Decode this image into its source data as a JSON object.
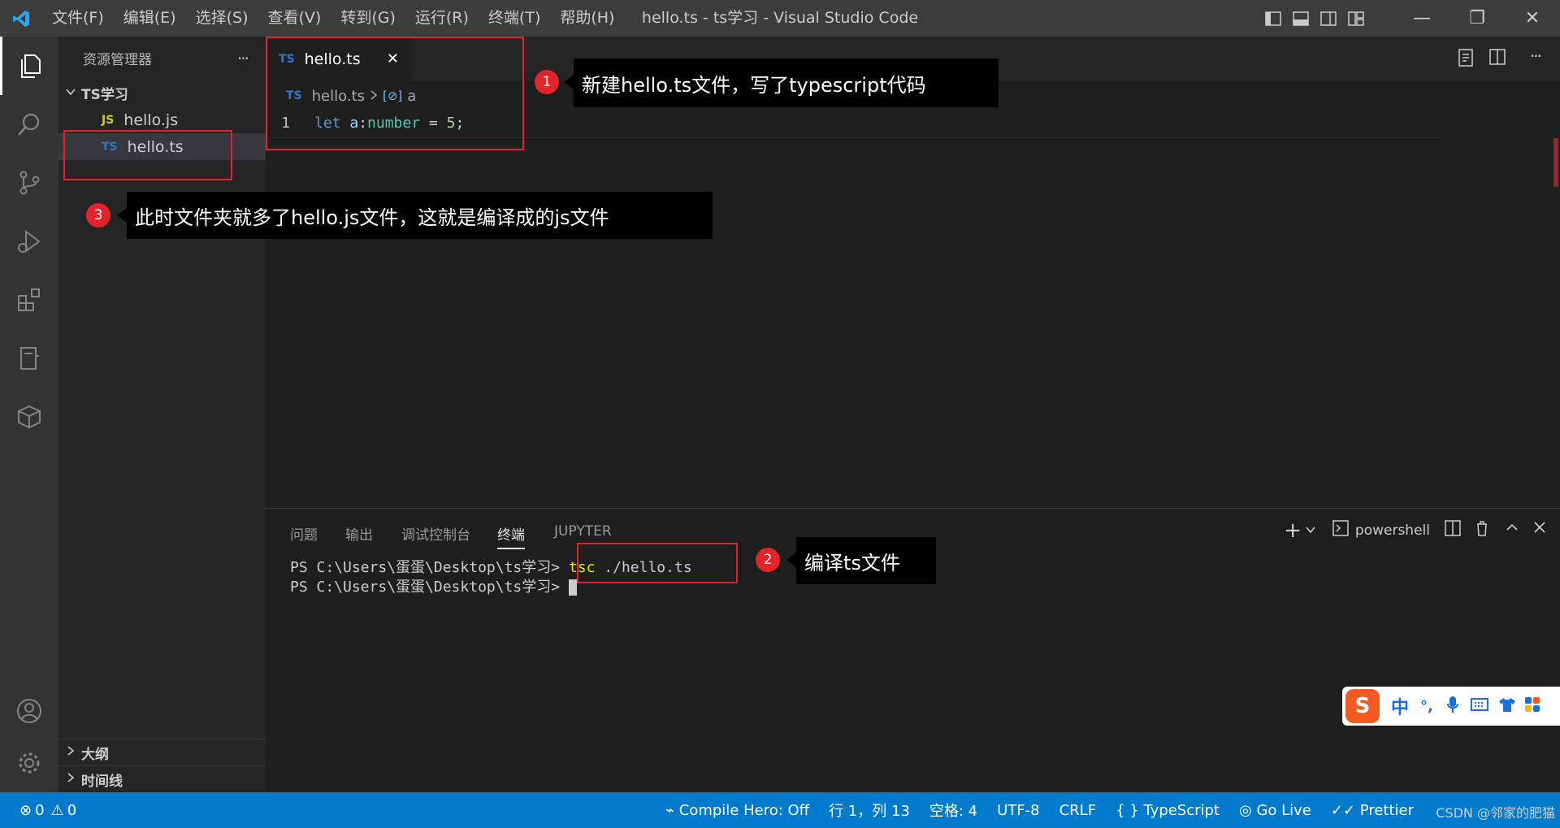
{
  "titlebar": {
    "menu": [
      "文件(F)",
      "编辑(E)",
      "选择(S)",
      "查看(V)",
      "转到(G)",
      "运行(R)",
      "终端(T)",
      "帮助(H)"
    ],
    "title": "hello.ts - ts学习 - Visual Studio Code",
    "min": "—",
    "max": "❐",
    "close": "✕"
  },
  "sidebar": {
    "title": "资源管理器",
    "more": "···",
    "folder": "TS学习",
    "files": [
      {
        "badge": "JS",
        "name": "hello.js"
      },
      {
        "badge": "TS",
        "name": "hello.ts"
      }
    ],
    "outline": "大纲",
    "timeline": "时间线"
  },
  "editor": {
    "tab": {
      "badge": "TS",
      "name": "hello.ts",
      "close": "✕"
    },
    "breadcrumb": {
      "badge": "TS",
      "file": "hello.ts",
      "symbol": "a"
    },
    "line_number": "1",
    "code": {
      "kw": "let ",
      "var": "a",
      "colon": ":",
      "type": "number",
      "rest": " = ",
      "num": "5",
      "semi": ";"
    }
  },
  "panel": {
    "tabs": [
      "问题",
      "输出",
      "调试控制台",
      "终端",
      "JUPYTER"
    ],
    "active_tab": "终端",
    "shell": "powershell",
    "lines": [
      {
        "prompt": "PS C:\\Users\\蛋蛋\\Desktop\\ts学习> ",
        "cmd": "tsc",
        "args": " ./hello.ts"
      },
      {
        "prompt": "PS C:\\Users\\蛋蛋\\Desktop\\ts学习> ",
        "cmd": "",
        "args": ""
      }
    ]
  },
  "statusbar": {
    "errors": "0",
    "warnings": "0",
    "compile_hero": "Compile Hero: Off",
    "position": "行 1，列 13",
    "spaces": "空格: 4",
    "encoding": "UTF-8",
    "eol": "CRLF",
    "language": "TypeScript",
    "go_live": "Go Live",
    "prettier": "Prettier",
    "watermark": "CSDN @邻家的肥猫"
  },
  "annotations": [
    {
      "num": "1",
      "text": "新建hello.ts文件，写了typescript代码"
    },
    {
      "num": "2",
      "text": "编译ts文件"
    },
    {
      "num": "3",
      "text": "此时文件夹就多了hello.js文件，这就是编译成的js文件"
    }
  ],
  "ime": {
    "lang": "中",
    "punct": "°,"
  },
  "colors": {
    "accent": "#007acc",
    "annotation_red": "#e0242a"
  }
}
